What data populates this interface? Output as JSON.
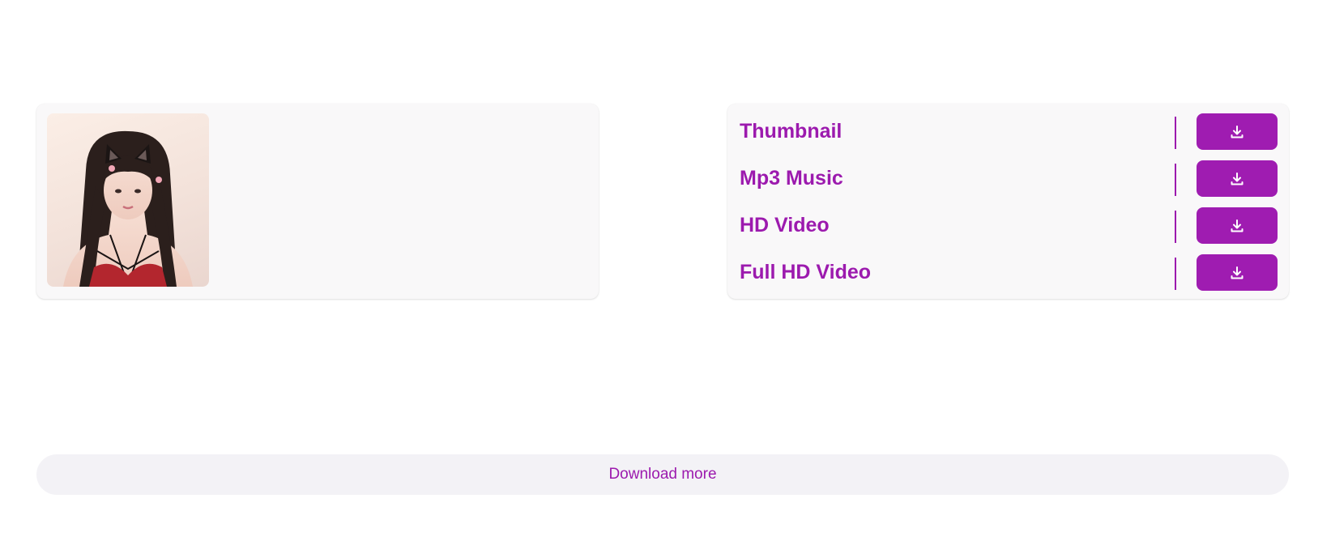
{
  "preview": {
    "thumbnail_alt": "Video thumbnail preview"
  },
  "options": [
    {
      "label": "Thumbnail",
      "icon": "download-icon"
    },
    {
      "label": "Mp3 Music",
      "icon": "download-icon"
    },
    {
      "label": "HD Video",
      "icon": "download-icon"
    },
    {
      "label": "Full HD Video",
      "icon": "download-icon"
    }
  ],
  "more": {
    "label": "Download more"
  },
  "colors": {
    "accent": "#9f1cb1",
    "card_bg": "#f9f8f9",
    "more_bg": "#f3f2f6"
  }
}
